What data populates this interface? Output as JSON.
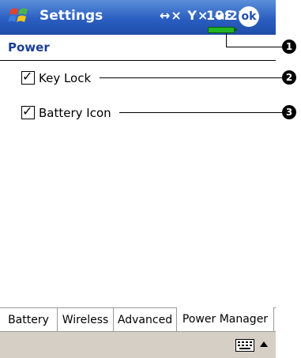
{
  "titlebar": {
    "title": "Settings",
    "status_icons": "↔× Y× ◄ℇ",
    "time": "10:21",
    "ok_label": "ok"
  },
  "heading": {
    "title": "Power"
  },
  "checkboxes": [
    {
      "label": "Key Lock",
      "checked": true,
      "check_mark": "✓"
    },
    {
      "label": "Battery Icon",
      "checked": true,
      "check_mark": "✓"
    }
  ],
  "tabs": [
    {
      "label": "Battery"
    },
    {
      "label": "Wireless"
    },
    {
      "label": "Advanced"
    },
    {
      "label": "Power Manager",
      "active": true
    }
  ],
  "callouts": [
    "1",
    "2",
    "3"
  ],
  "colors": {
    "titlebar": "#2a5ec1",
    "heading_text": "#1c3f96",
    "battery": "#22b422",
    "menubar": "#d6cfc6"
  }
}
